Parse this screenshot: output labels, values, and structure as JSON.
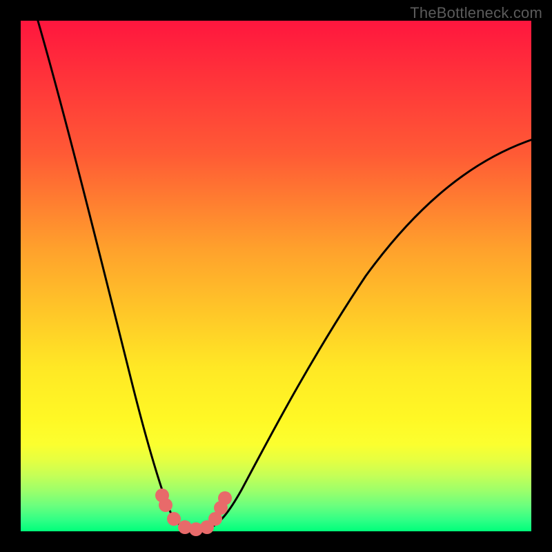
{
  "watermark": "TheBottleneck.com",
  "chart_data": {
    "type": "line",
    "title": "",
    "xlabel": "",
    "ylabel": "",
    "xlim": [
      0,
      100
    ],
    "ylim": [
      0,
      100
    ],
    "grid": false,
    "series": [
      {
        "name": "curve",
        "x": [
          3,
          6,
          9,
          12,
          15,
          18,
          21,
          23,
          25,
          27,
          28.5,
          30,
          32,
          34,
          36,
          38,
          40,
          44,
          50,
          56,
          62,
          70,
          80,
          90,
          100
        ],
        "values": [
          100,
          90,
          80,
          70,
          60,
          50,
          40,
          30,
          20,
          12,
          5,
          1,
          0,
          0,
          0.5,
          2,
          5,
          12,
          22,
          32,
          42,
          53,
          65,
          74,
          78
        ]
      }
    ],
    "markers": {
      "name": "highlighted-points",
      "x": [
        27,
        28.5,
        30,
        32,
        34,
        36,
        38
      ],
      "values": [
        12,
        5,
        1,
        0,
        0,
        0.5,
        2
      ],
      "color": "#e86a6a"
    },
    "background_gradient": {
      "top": "#ff163e",
      "mid": "#ffe825",
      "bottom": "#00ff7a"
    }
  }
}
